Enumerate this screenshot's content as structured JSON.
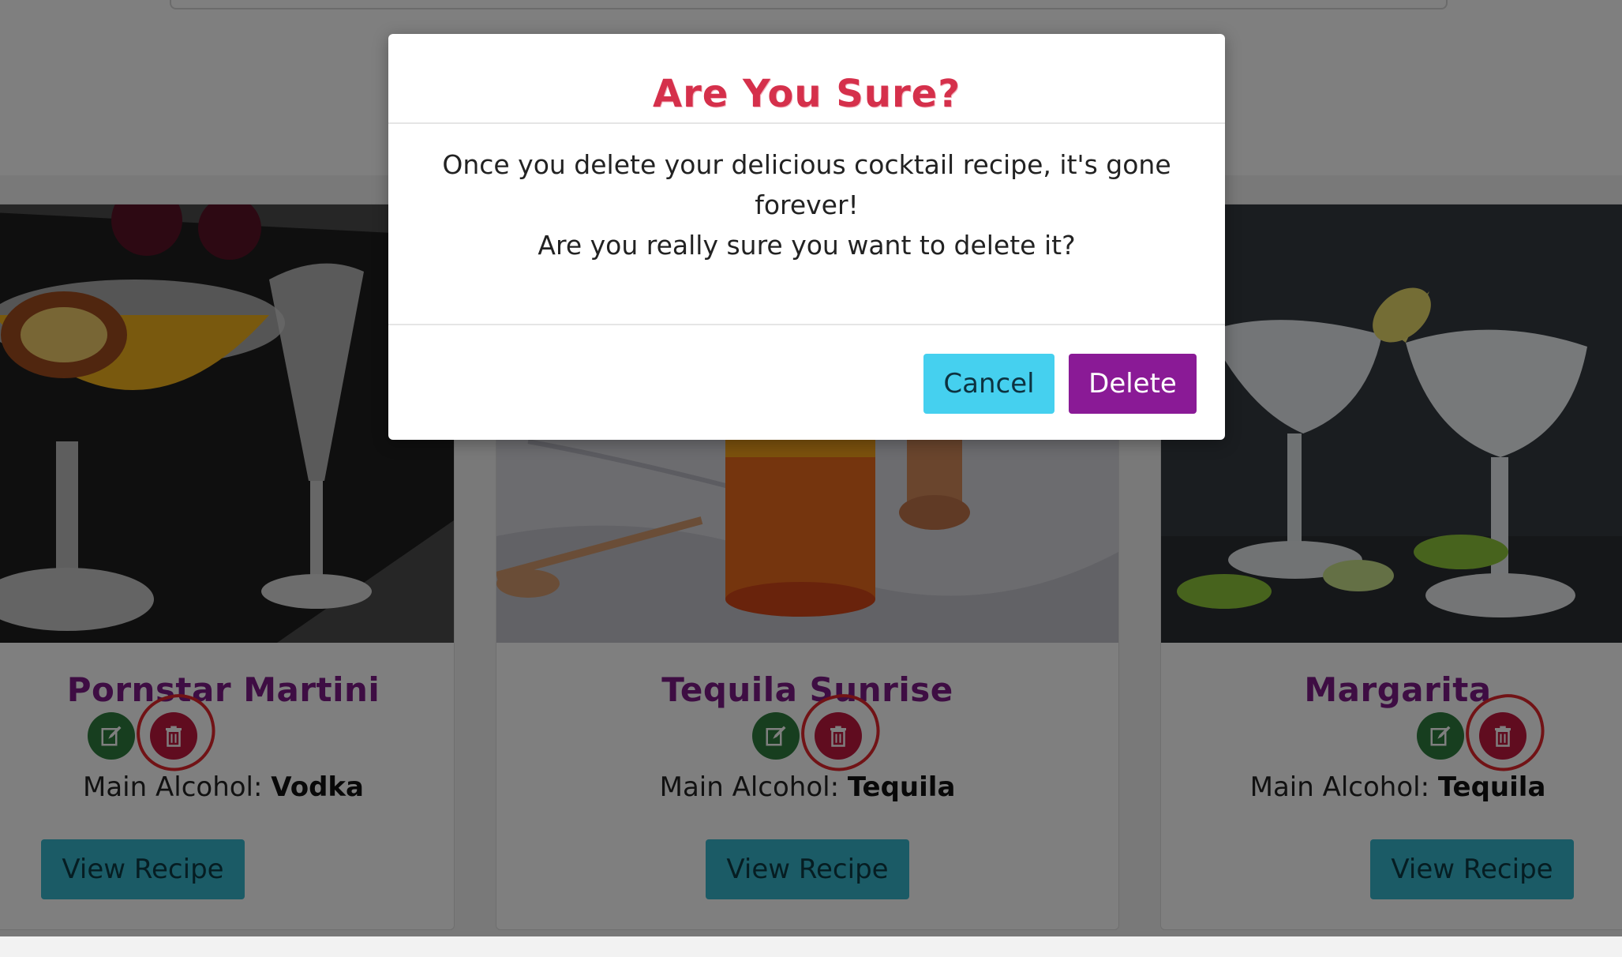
{
  "modal": {
    "title": "Are You Sure?",
    "body_line1": "Once you delete your delicious cocktail recipe, it's gone forever!",
    "body_line2": "Are you really sure you want to delete it?",
    "cancel_label": "Cancel",
    "delete_label": "Delete"
  },
  "cards": [
    {
      "title": "Pornstar Martini",
      "alcohol_label": "Main Alcohol:",
      "alcohol_value": "Vodka",
      "view_label": "View Recipe",
      "edit_icon": "edit-icon",
      "delete_icon": "trash-icon"
    },
    {
      "title": "Tequila Sunrise",
      "alcohol_label": "Main Alcohol:",
      "alcohol_value": "Tequila",
      "view_label": "View Recipe",
      "edit_icon": "edit-icon",
      "delete_icon": "trash-icon"
    },
    {
      "title": "Margarita",
      "alcohol_label": "Main Alcohol:",
      "alcohol_value": "Tequila",
      "view_label": "View Recipe",
      "edit_icon": "edit-icon",
      "delete_icon": "trash-icon"
    }
  ],
  "colors": {
    "title_purple": "#7d1a86",
    "edit_green": "#2f7d3e",
    "delete_red": "#c1183e",
    "view_teal": "#37b6cc",
    "modal_title_red": "#d5304b",
    "cancel_cyan": "#45d0ef",
    "delete_purple": "#8a1a96"
  }
}
